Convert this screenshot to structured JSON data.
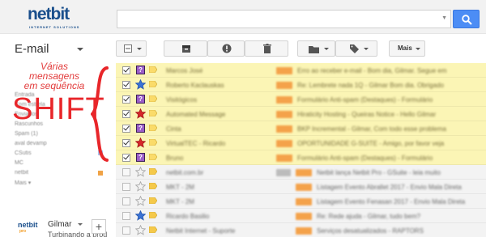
{
  "brand": {
    "name": "netbit",
    "tagline": "INTERNET SOLUTIONS"
  },
  "app": {
    "title": "E-mail"
  },
  "toolbar": {
    "more_label": "Mais"
  },
  "annotation": {
    "lines": [
      "Várias",
      "mensagens",
      "em sequência"
    ],
    "key": "SHIFT",
    "color": "#e8262a"
  },
  "sidebar": {
    "items": [
      "Entrada",
      "Com estrela",
      "Enviados",
      "Rascunhos",
      "Spam (1)",
      "aval devamp",
      "CSutis",
      "MC",
      "netbit",
      "Mais ▾"
    ]
  },
  "footer": {
    "logo": "netbit",
    "logo_sub": "pro",
    "user_name": "Gilmar",
    "status": "Turbinando a prod",
    "add_label": "+"
  },
  "emails": [
    {
      "selected": true,
      "icon": "question",
      "sender": "Marcos José",
      "label": "Xpto",
      "subject": "Erro ao receber e-mail - Bom dia, Gilmar. Segue em"
    },
    {
      "selected": true,
      "icon": "star-blue",
      "sender": "Roberto Kaclauskas",
      "label": "Xpto",
      "subject": "Re: Lembrete nada 1Q - Gilmar Bom dia. Obrigado"
    },
    {
      "selected": true,
      "icon": "question",
      "sender": "Visitógicos",
      "label": "Xpto",
      "subject": "Formulário Anti-spam (Destaques) - Formulário"
    },
    {
      "selected": true,
      "icon": "star-red",
      "sender": "Automated Message",
      "label": "Xpto",
      "subject": "Hiraticity Hosting - Queiras Notice - Hello Gilmar"
    },
    {
      "selected": true,
      "icon": "question",
      "sender": "Cinta",
      "label": "Xpto",
      "subject": "BKP Incremental - Gilmar, Com todo esse problema"
    },
    {
      "selected": true,
      "icon": "star-red",
      "sender": "VirtualTEC - Ricardo",
      "label": "Xpto",
      "subject": "OPORTUNIDADE G-SUITE - Amigo, por favor veja"
    },
    {
      "selected": true,
      "icon": "question",
      "sender": "Bruno",
      "label": "Xpto",
      "subject": "Formulário Anti-spam (Destaques) - Formulário"
    },
    {
      "selected": false,
      "icon": "star-empty",
      "sender": "netbit.com.br",
      "label": "Xpto",
      "subject": "Netbit lança Netbit Pro - GSuite - leia muito"
    },
    {
      "selected": false,
      "icon": "star-empty",
      "sender": "MKT - 2M",
      "label": "Xpto",
      "subject": "Listagem Evento Abrallet 2017 - Envio Mala Direta"
    },
    {
      "selected": false,
      "icon": "star-empty",
      "sender": "MKT - 2M",
      "label": "Xpto",
      "subject": "Listagem Evento Fenasan 2017 - Envio Mala Direta"
    },
    {
      "selected": false,
      "icon": "star-blue",
      "sender": "Ricardo Basilio",
      "label": "Xpto",
      "subject": "Re: Rede ajuda - Gilmar, tudo bem?"
    },
    {
      "selected": false,
      "icon": "star-empty",
      "sender": "Netbit Internet - Suporte",
      "label": "Xpto",
      "subject": "Serviços desatualizados - RAPTORS"
    }
  ],
  "colors": {
    "selected_row": "#fbf5b5",
    "unselected_row": "#f3f3f3",
    "accent": "#4c8df5",
    "brand": "#1a4f8c"
  }
}
